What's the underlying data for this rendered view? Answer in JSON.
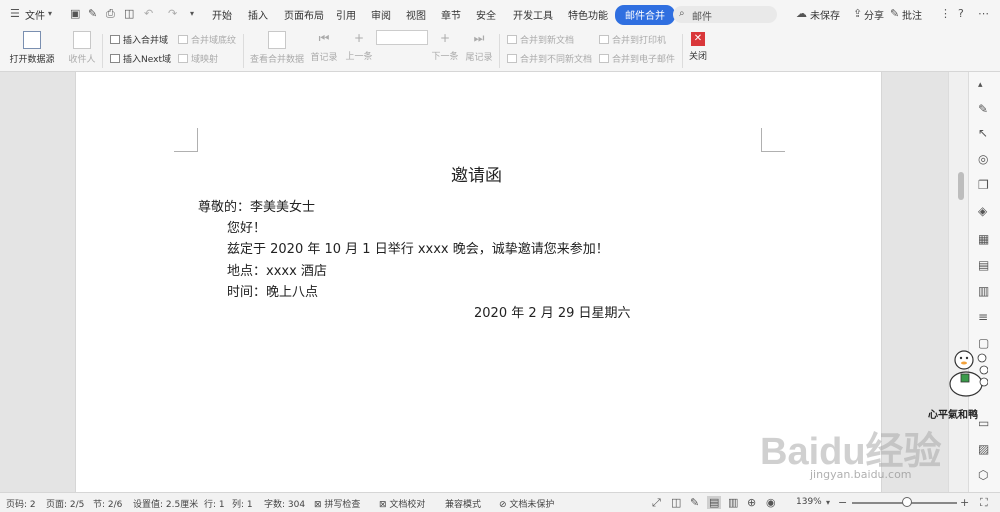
{
  "menubar": {
    "file": "文件",
    "tabs": [
      "开始",
      "插入",
      "页面布局",
      "引用",
      "审阅",
      "视图",
      "章节",
      "安全",
      "开发工具",
      "特色功能",
      "邮件合并"
    ],
    "search_text": "邮件",
    "unsaved": "未保存",
    "share": "分享",
    "comment": "批注"
  },
  "ribbon": {
    "open_source": "打开数据源",
    "recipient": "收件人",
    "insert_merge_field": "插入合并域",
    "merge_field_shading": "合并域底纹",
    "insert_next_field": "插入Next域",
    "field_mapping": "域映射",
    "view_merged": "查看合并数据",
    "first_record": "首记录",
    "prev": "上一条",
    "next": "下一条",
    "last_record": "尾记录",
    "merge_to_new": "合并到新文档",
    "merge_to_diff": "合并到不同新文档",
    "merge_to_printer": "合并到打印机",
    "merge_to_email": "合并到电子邮件",
    "close": "关闭"
  },
  "document": {
    "title": "邀请函",
    "greeting": "尊敬的：李美美女士",
    "hello": "您好！",
    "body": "兹定于 2020 年 10 月 1 日举行 xxxx 晚会，诚挚邀请您来参加！",
    "location": "地点：xxxx 酒店",
    "time": "时间：晚上八点",
    "date": "2020 年 2 月 29 日星期六"
  },
  "statusbar": {
    "page_num": "页码: 2",
    "page_count": "页面: 2/5",
    "section": "节: 2/6",
    "setting": "设置值: 2.5厘米",
    "row": "行: 1",
    "col": "列: 1",
    "word_count": "字数: 304",
    "spell_check": "拼写检查",
    "doc_check": "文档校对",
    "compat_mode": "兼容模式",
    "unprotected": "文档未保护",
    "zoom": "139%"
  },
  "watermark": {
    "mascot_text": "心平氣和鸭",
    "brand": "Baidu经验",
    "url": "jingyan.baidu.com"
  },
  "colors": {
    "accent": "#2f6fe0",
    "close_red": "#d9373a"
  },
  "icons": {
    "menu": "menu-icon",
    "save": "save-icon",
    "print": "print-icon",
    "undo": "undo-icon",
    "redo": "redo-icon",
    "search": "search-icon",
    "cloud": "cloud-icon",
    "help": "help-icon"
  }
}
